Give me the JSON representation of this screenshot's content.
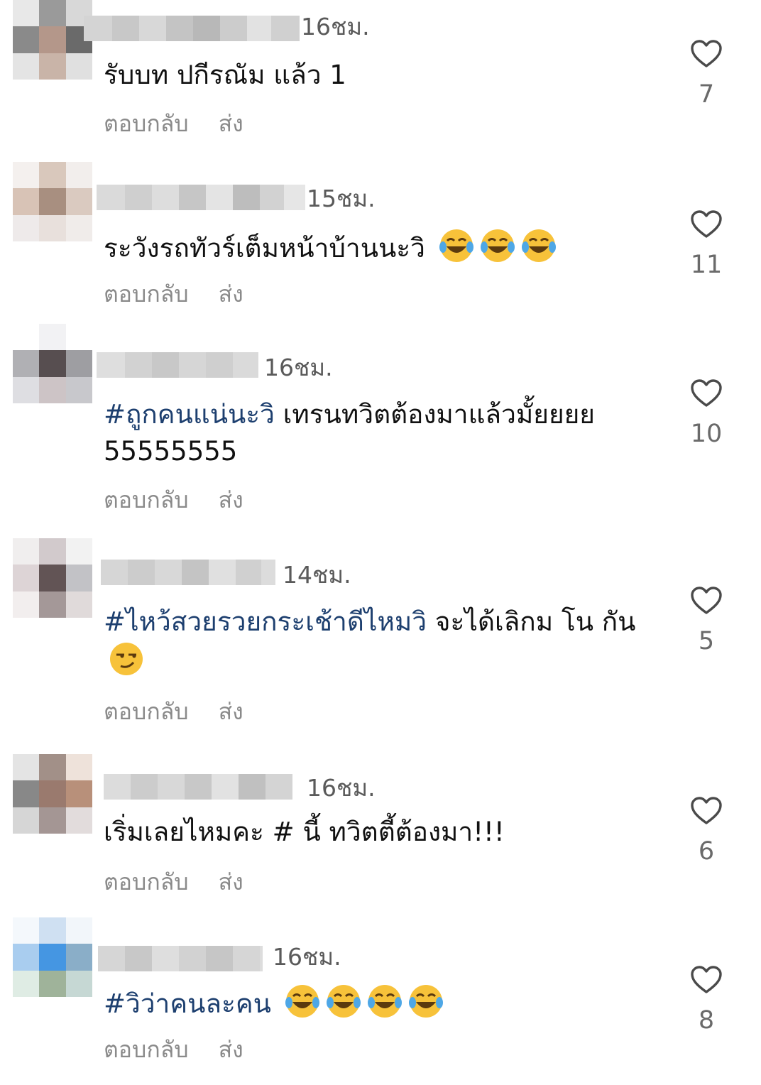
{
  "colors": {
    "hashtag": "#1d3f6f",
    "secondary_text": "#8a8a8a",
    "timestamp": "#5a5a5a"
  },
  "icons": {
    "like": "heart-outline-icon",
    "emoji": "tears-of-joy-emoji",
    "emoji_alt": "smirking-face-emoji"
  },
  "comments": [
    {
      "time": "16ชม.",
      "text": "รับบท ปกีรณัม แล้ว 1",
      "reply_label": "ตอบกลับ",
      "send_label": "ส่ง",
      "likes": "7"
    },
    {
      "time": "15ชม.",
      "text": "ระวังรถทัวร์เต็มหน้าบ้านนะวิ",
      "emojis": [
        "😂",
        "😂",
        "😂"
      ],
      "reply_label": "ตอบกลับ",
      "send_label": "ส่ง",
      "likes": "11"
    },
    {
      "time": "16ชม.",
      "hashtag": "#ถูกคนแน่นะวิ",
      "text": " เทรนทวิตต้องมาแล้วมั้ยยยย 55555555",
      "reply_label": "ตอบกลับ",
      "send_label": "ส่ง",
      "likes": "10"
    },
    {
      "time": "14ชม.",
      "hashtag": "#ไหว้สวยรวยกระเช้าดีไหมวิ",
      "text": " จะได้เลิกม โน กัน",
      "emojis": [
        "😏"
      ],
      "reply_label": "ตอบกลับ",
      "send_label": "ส่ง",
      "likes": "5"
    },
    {
      "time": "16ชม.",
      "text": "เริ่มเลยไหมคะ # นี้ ทวิตตี้ต้องมา!!!",
      "reply_label": "ตอบกลับ",
      "send_label": "ส่ง",
      "likes": "6"
    },
    {
      "time": "16ชม.",
      "hashtag": "#วิว่าคนละคน",
      "emojis": [
        "😂",
        "😂",
        "😂",
        "😂"
      ],
      "reply_label": "ตอบกลับ",
      "send_label": "ส่ง",
      "likes": "8"
    }
  ]
}
